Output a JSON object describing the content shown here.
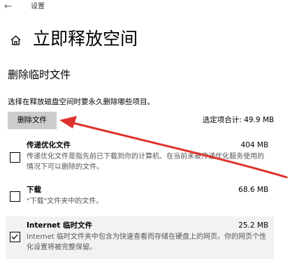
{
  "window": {
    "title": "设置",
    "back_glyph": "←"
  },
  "header": {
    "title": "立即释放空间"
  },
  "section": {
    "title": "删除临时文件",
    "description": "选择在释放磁盘空间时要永久删除哪些项目。",
    "delete_button_label": "删除文件",
    "total_label": "选定项合计: 49.9 MB"
  },
  "items": [
    {
      "name": "传递优化文件",
      "size": "404 MB",
      "description": "传递优化文件是指先前已下载到你的计算机、在当前未被传递优化服务使用的情况下可以删除的文件。",
      "checked": false
    },
    {
      "name": "下载",
      "size": "68.6 MB",
      "description": "\"下载\"文件夹中的文件。",
      "checked": false
    },
    {
      "name": "Internet 临时文件",
      "size": "25.2 MB",
      "description": "Internet 临时文件夹中包含为快速查看而存储在硬盘上的网页。你的网页个性化设置将被完整保留。",
      "checked": true
    }
  ],
  "colors": {
    "annotation_arrow": "#e0322c",
    "button_bg": "#cccccc",
    "highlight_bg": "#f2f2f2"
  }
}
